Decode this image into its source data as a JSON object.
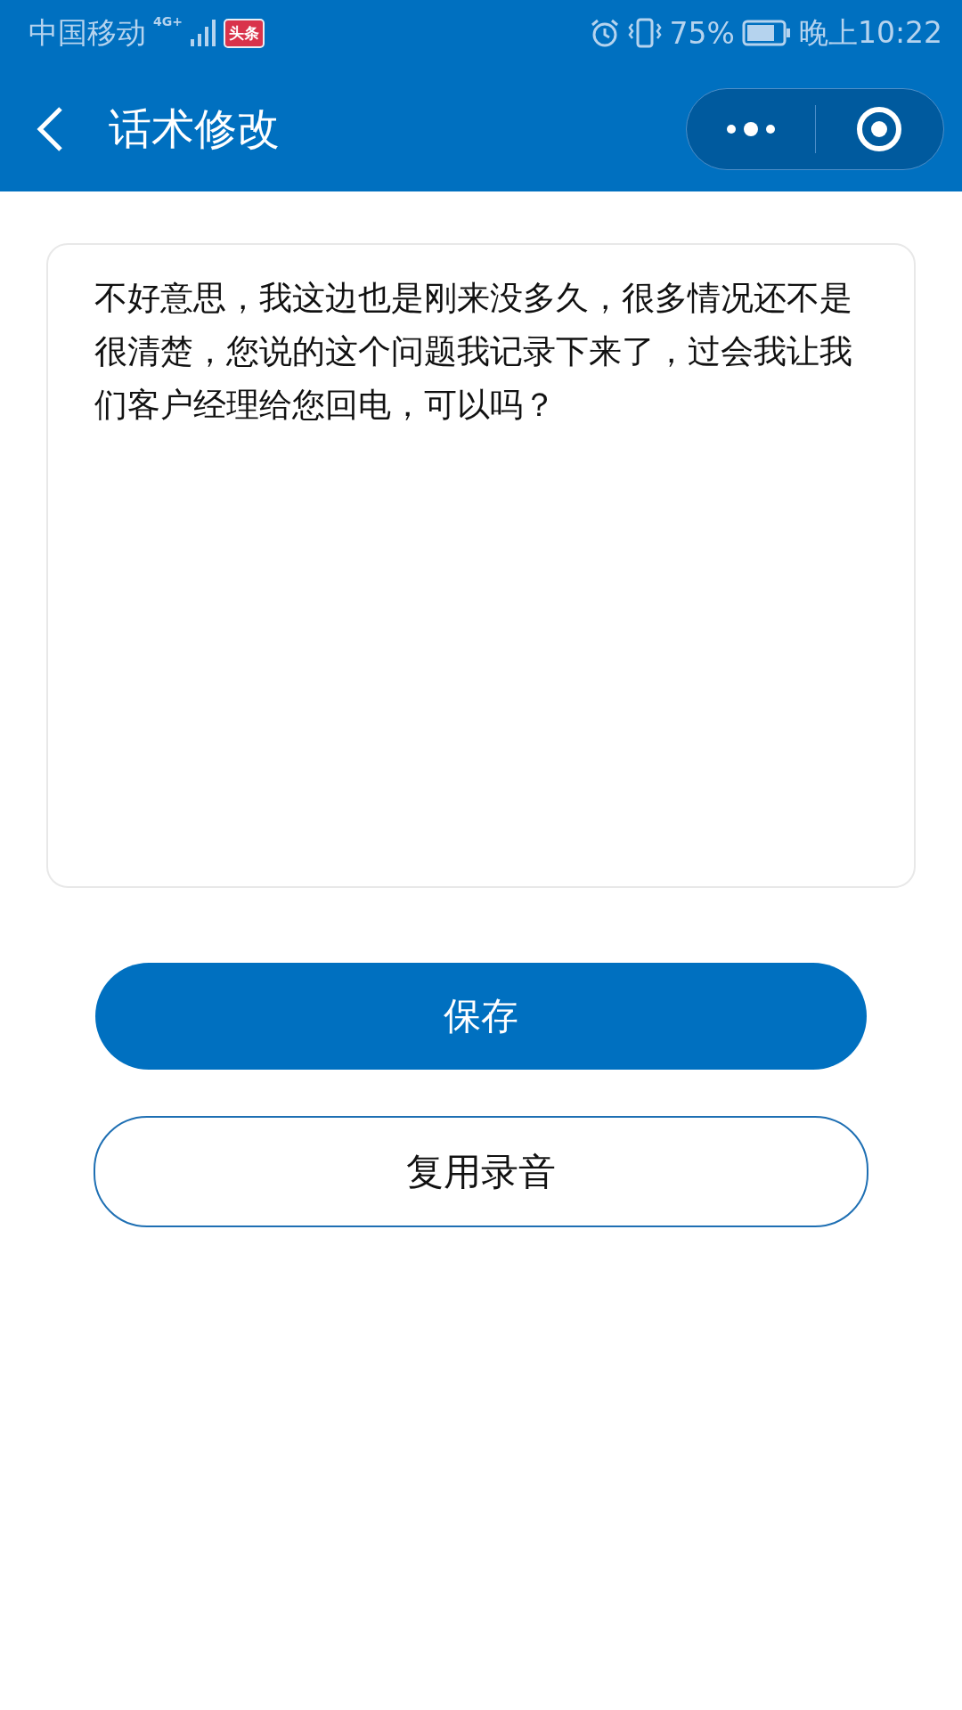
{
  "status_bar": {
    "carrier": "中国移动",
    "network": "4G+",
    "app_badge": "头条",
    "battery": "75%",
    "time": "晚上10:22"
  },
  "header": {
    "title": "话术修改"
  },
  "script_field": {
    "value": "不好意思，我这边也是刚来没多久，很多情况还不是很清楚，您说的这个问题我记录下来了，过会我让我们客户经理给您回电，可以吗？"
  },
  "buttons": [
    {
      "label": "保存",
      "kind": "primary"
    },
    {
      "label": "复用录音",
      "kind": "outline"
    }
  ]
}
